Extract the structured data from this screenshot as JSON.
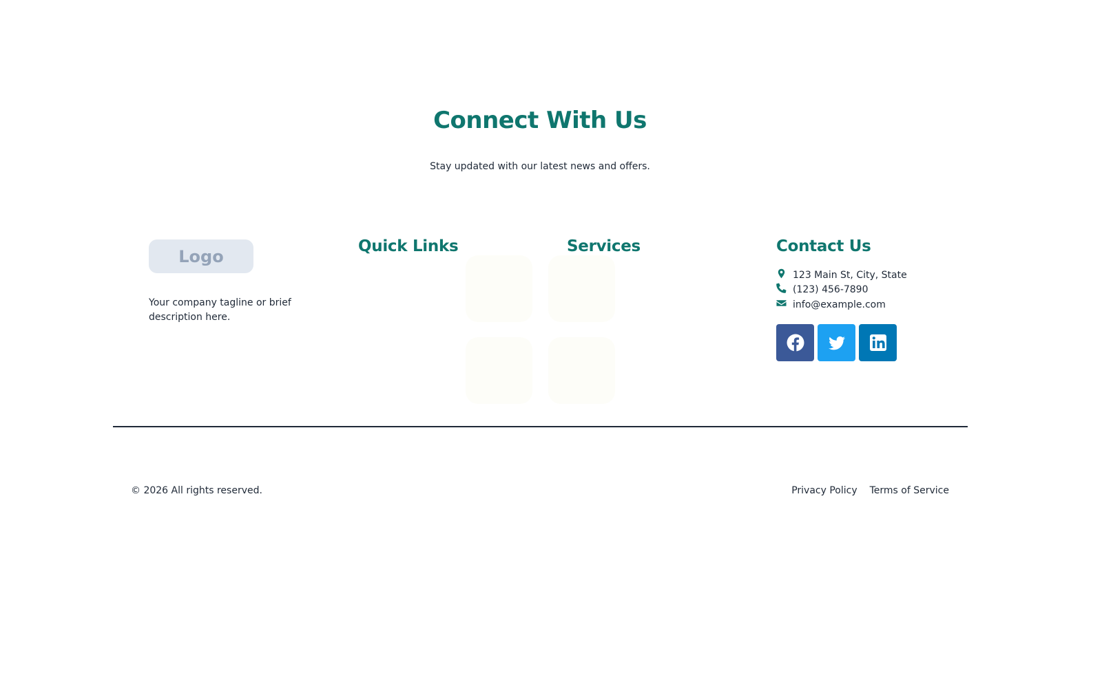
{
  "hero": {
    "title": "Connect With Us",
    "subtitle": "Stay updated with our latest news and offers."
  },
  "brand": {
    "logo_text": "Logo",
    "tagline": "Your company tagline or brief description here."
  },
  "columns": {
    "quick_links_heading": "Quick Links",
    "services_heading": "Services",
    "contact_heading": "Contact Us"
  },
  "contact": {
    "address": "123 Main St, City, State",
    "phone": "(123) 456-7890",
    "email": "info@example.com",
    "address_icon": "map-marker-icon",
    "phone_icon": "phone-icon",
    "email_icon": "envelope-icon"
  },
  "social": [
    {
      "icon": "facebook-icon",
      "color": "#3b5998"
    },
    {
      "icon": "twitter-icon",
      "color": "#1da1f2"
    },
    {
      "icon": "linkedin-icon",
      "color": "#0077b5"
    }
  ],
  "footer": {
    "copyright": "© 2026 All rights reserved.",
    "privacy": "Privacy Policy",
    "terms": "Terms of Service"
  },
  "colors": {
    "accent": "#0f766e",
    "text": "#1f2937",
    "logo_bg": "#e2e8f0"
  }
}
